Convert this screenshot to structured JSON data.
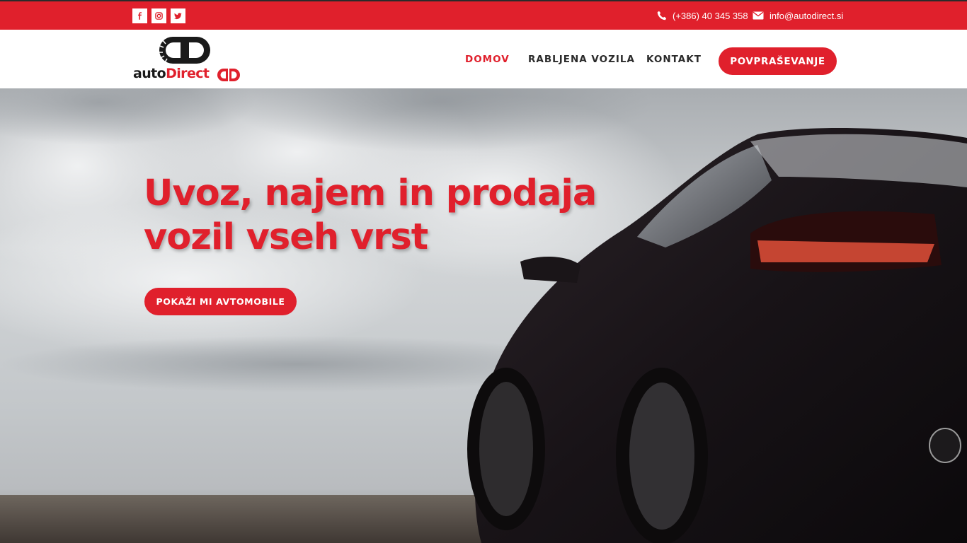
{
  "topbar": {
    "social": [
      {
        "icon": "facebook-icon"
      },
      {
        "icon": "instagram-icon"
      },
      {
        "icon": "twitter-icon"
      }
    ],
    "phone": "(+386) 40 345 358",
    "email": "info@autodirect.si"
  },
  "logo": {
    "text_main": "auto",
    "text_accent": "Direct"
  },
  "nav": {
    "items": [
      {
        "label": "DOMOV",
        "active": true
      },
      {
        "label": "RABLJENA VOZILA",
        "active": false
      },
      {
        "label": "KONTAKT",
        "active": false
      }
    ],
    "cta_label": "POVPRAŠEVANJE"
  },
  "hero": {
    "headline_line1": "Uvoz, najem in prodaja",
    "headline_line2": "vozil vseh vrst",
    "button_label": "POKAŽI MI AVTOMOBILE"
  },
  "colors": {
    "brand_red": "#e0202c",
    "nav_text": "#2b2b2b",
    "white": "#ffffff"
  }
}
